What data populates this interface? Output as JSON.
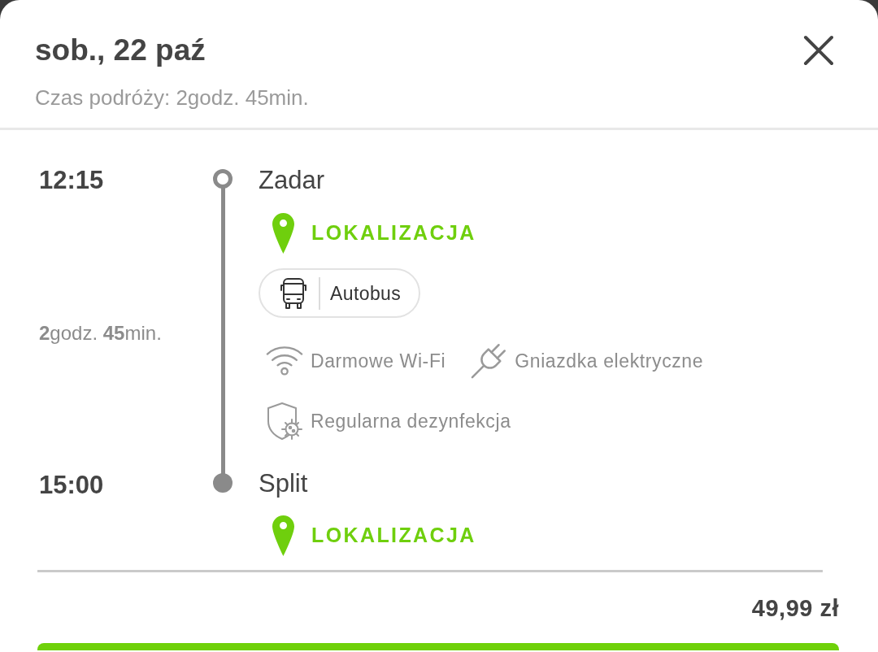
{
  "header": {
    "title": "sob., 22 paź",
    "subtitle": "Czas podróży: 2godz. 45min."
  },
  "route": {
    "stops": [
      {
        "kind": "start",
        "time": "12:15",
        "city": "Zadar",
        "location_link": "LOKALIZACJA"
      },
      {
        "kind": "end",
        "time": "15:00",
        "city": "Split",
        "location_link": "LOKALIZACJA"
      }
    ],
    "duration": "**2**godz. **45**min.",
    "vehicle": {
      "kind": "bus",
      "label": "Autobus"
    },
    "amenities": [
      {
        "kind": "wifi",
        "label": "Darmowe Wi-Fi"
      },
      {
        "kind": "plug",
        "label": "Gniazdka elektryczne"
      },
      {
        "kind": "disinfection",
        "label": "Regularna dezynfekcja"
      }
    ]
  },
  "price": "49,99 zł"
}
